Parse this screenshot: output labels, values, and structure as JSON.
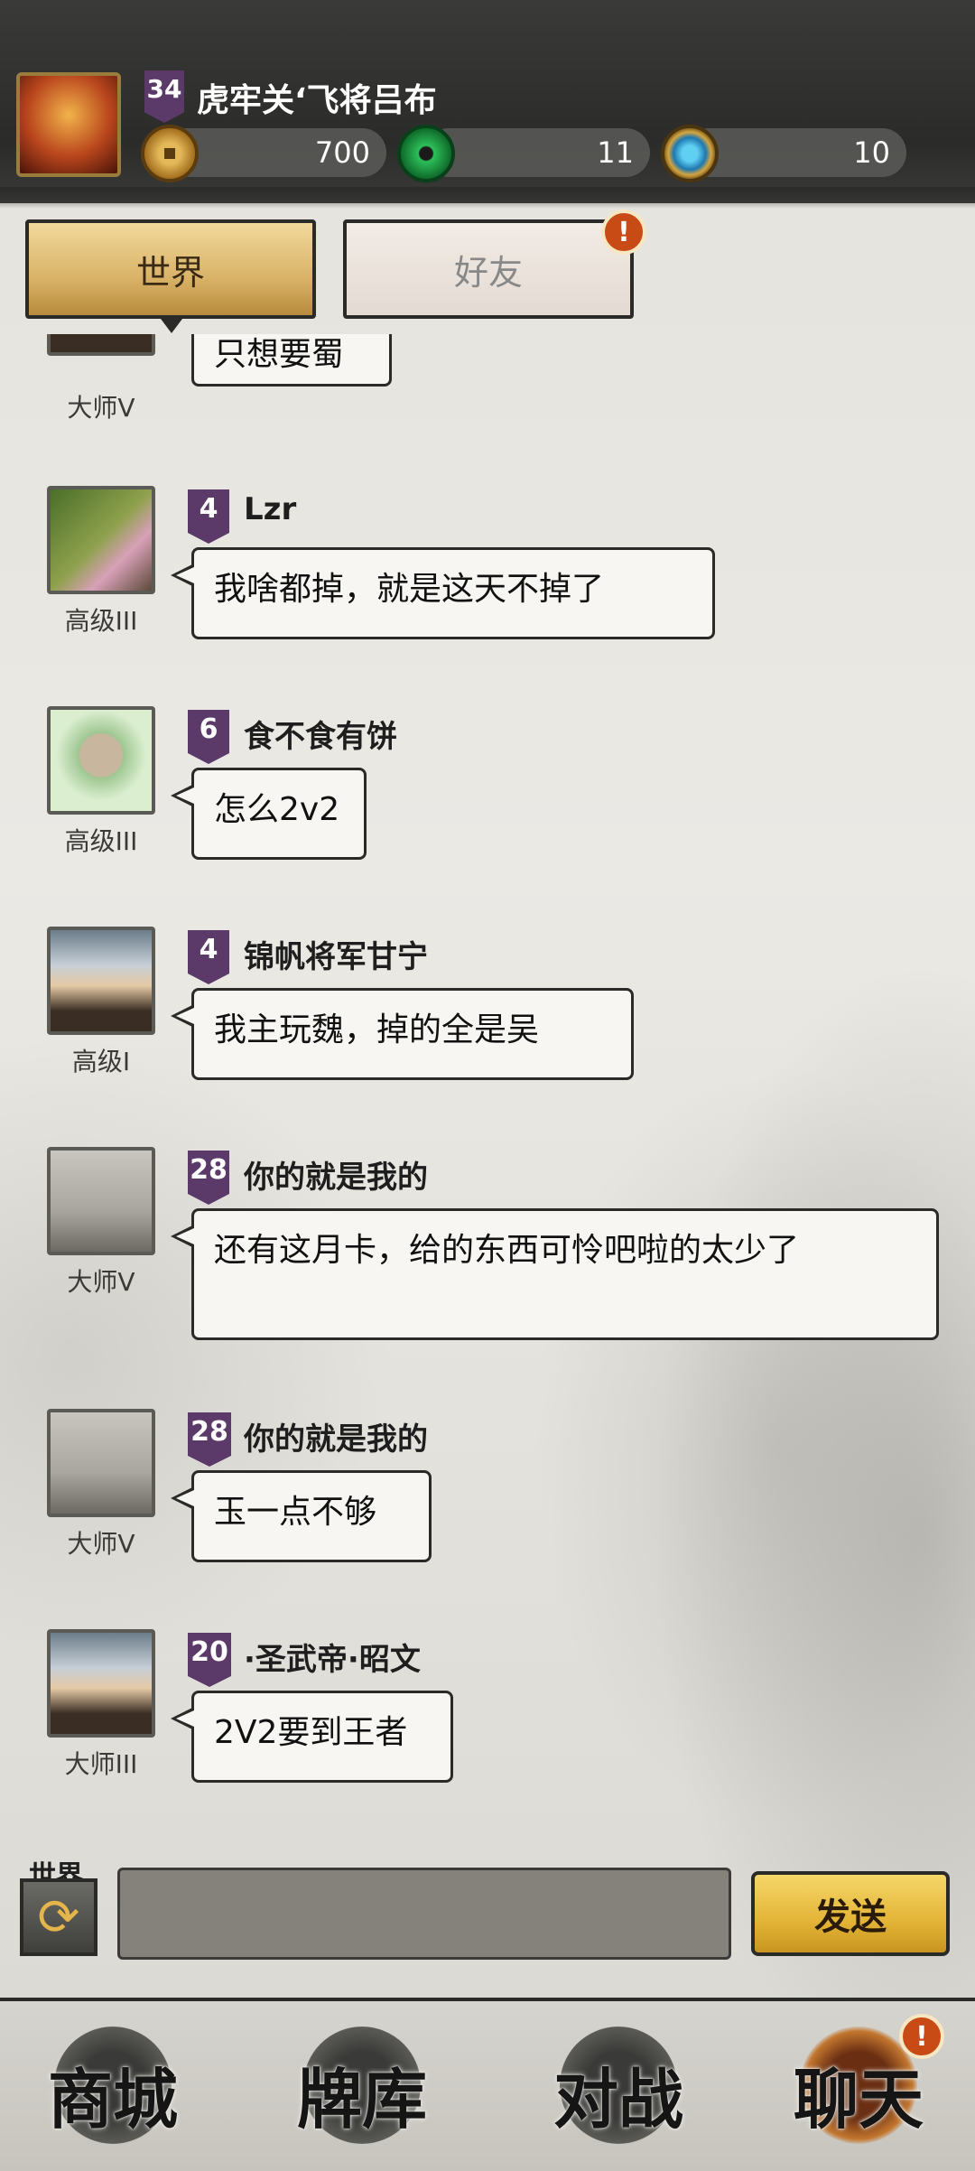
{
  "player": {
    "level": "34",
    "name": "虎牢关‘飞将吕布",
    "avatar_icon": "warrior-portrait-icon"
  },
  "currencies": [
    {
      "icon": "coin-icon",
      "value": "700"
    },
    {
      "icon": "jade-icon",
      "value": "11"
    },
    {
      "icon": "gem-icon",
      "value": "10"
    }
  ],
  "tabs": {
    "world_label": "世界",
    "friends_label": "好友",
    "friends_alert": "!"
  },
  "messages": [
    {
      "rank": "大师V",
      "text": "只想要蜀"
    },
    {
      "level": "4",
      "name": "Lzr",
      "rank": "高级III",
      "text": "我啥都掉，就是这天不掉了"
    },
    {
      "level": "6",
      "name": "食不食有饼",
      "rank": "高级III",
      "text": "怎么2v2"
    },
    {
      "level": "4",
      "name": "锦帆将军甘宁",
      "rank": "高级I",
      "text": "我主玩魏，掉的全是吴"
    },
    {
      "level": "28",
      "name": "你的就是我的",
      "rank": "大师V",
      "text": "还有这月卡，给的东西可怜吧啦的太少了"
    },
    {
      "level": "28",
      "name": "你的就是我的",
      "rank": "大师V",
      "text": "玉一点不够"
    },
    {
      "level": "20",
      "name": "·圣武帝·昭文",
      "rank": "大师III",
      "text": "2V2要到王者"
    }
  ],
  "input_bar": {
    "channel_label": "世界",
    "switch_icon": "refresh-icon",
    "input_value": "",
    "send_label": "发送"
  },
  "bottom_nav": [
    {
      "label": "商城"
    },
    {
      "label": "牌库"
    },
    {
      "label": "对战"
    },
    {
      "label": "聊天",
      "alert": "!"
    }
  ],
  "colors": {
    "accent_gold": "#e3b436",
    "alert_orange": "#c84b16",
    "level_flag": "#5b3a6a"
  }
}
